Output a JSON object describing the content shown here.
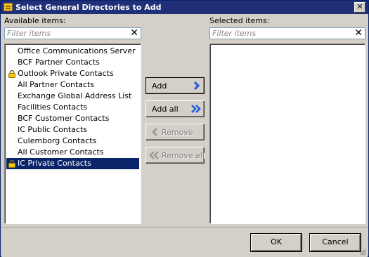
{
  "window": {
    "title": "Select General Directories to Add",
    "close_glyph": "✕"
  },
  "available": {
    "label": "Available items:",
    "filter_placeholder": "Filter items",
    "clear_glyph": "✕",
    "items": [
      {
        "label": "Office Communications Server",
        "locked": false,
        "selected": false
      },
      {
        "label": "BCF Partner Contacts",
        "locked": false,
        "selected": false
      },
      {
        "label": "Outlook Private Contacts",
        "locked": true,
        "selected": false
      },
      {
        "label": "All Partner Contacts",
        "locked": false,
        "selected": false
      },
      {
        "label": "Exchange Global Address List",
        "locked": false,
        "selected": false
      },
      {
        "label": "Facilities Contacts",
        "locked": false,
        "selected": false
      },
      {
        "label": "BCF Customer Contacts",
        "locked": false,
        "selected": false
      },
      {
        "label": "IC Public Contacts",
        "locked": false,
        "selected": false
      },
      {
        "label": "Culemborg Contacts",
        "locked": false,
        "selected": false
      },
      {
        "label": "All Customer Contacts",
        "locked": false,
        "selected": false
      },
      {
        "label": "IC Private Contacts",
        "locked": true,
        "selected": true
      }
    ]
  },
  "selected": {
    "label": "Selected items:",
    "filter_placeholder": "Filter items",
    "clear_glyph": "✕"
  },
  "buttons": {
    "add": "Add",
    "add_all": "Add all",
    "remove": "Remove",
    "remove_all": "Remove all",
    "ok": "OK",
    "cancel": "Cancel"
  },
  "icons": {
    "add": "chevron-right-icon",
    "add_all": "double-chevron-right-icon",
    "remove": "chevron-left-icon",
    "remove_all": "double-chevron-left-icon",
    "lock": "padlock-icon"
  },
  "colors": {
    "titlebar": "#1f2f78",
    "selection": "#0a246a",
    "accent_arrow": "#1e5bd6",
    "disabled_arrow": "#9a9a9a"
  }
}
